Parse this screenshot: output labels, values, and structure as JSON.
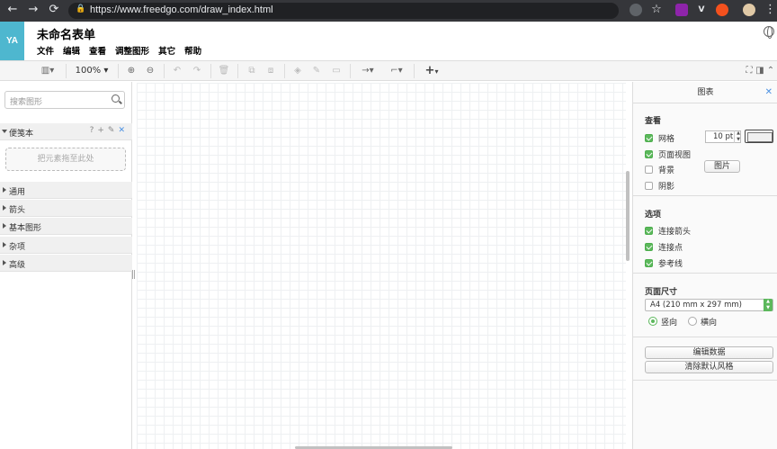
{
  "browser": {
    "url": "https://www.freedgo.com/draw_index.html",
    "lock_glyph": "🔒",
    "back_glyph": "←",
    "forward_glyph": "→",
    "reload_glyph": "⟳",
    "star_glyph": "☆",
    "menu_glyph": "⋮"
  },
  "app": {
    "avatar_text": "YA",
    "avatar_color": "#4eb7cf",
    "title": "未命名表单",
    "menus": [
      "文件",
      "编辑",
      "查看",
      "调整图形",
      "其它",
      "帮助"
    ]
  },
  "toolbar": {
    "zoom": "100%"
  },
  "sidebar": {
    "search_placeholder": "搜索图形",
    "scratchpad": {
      "label": "便笺本",
      "help": "?",
      "add": "+",
      "dropzone": "把元素拖至此处"
    },
    "sections": [
      "通用",
      "箭头",
      "基本图形",
      "杂项",
      "高级"
    ]
  },
  "panel": {
    "title": "图表",
    "view": {
      "title": "查看",
      "grid_label": "网格",
      "grid_checked": true,
      "grid_size": "10 pt",
      "page_view_label": "页面视图",
      "page_view_checked": true,
      "background_label": "背景",
      "background_checked": false,
      "image_button": "图片",
      "shadow_label": "阴影",
      "shadow_checked": false
    },
    "options": {
      "title": "选项",
      "connection_arrows": "连接箭头",
      "connection_points": "连接点",
      "guides": "参考线"
    },
    "page_size": {
      "title": "页面尺寸",
      "selected": "A4 (210 mm x 297 mm)",
      "portrait": "竖向",
      "landscape": "横向"
    },
    "edit_data_button": "编辑数据",
    "clear_style_button": "清除默认风格"
  },
  "colors": {
    "accent_green": "#5cb85c",
    "accent_blue": "#4a90e2",
    "chrome_dark": "#35363a"
  }
}
